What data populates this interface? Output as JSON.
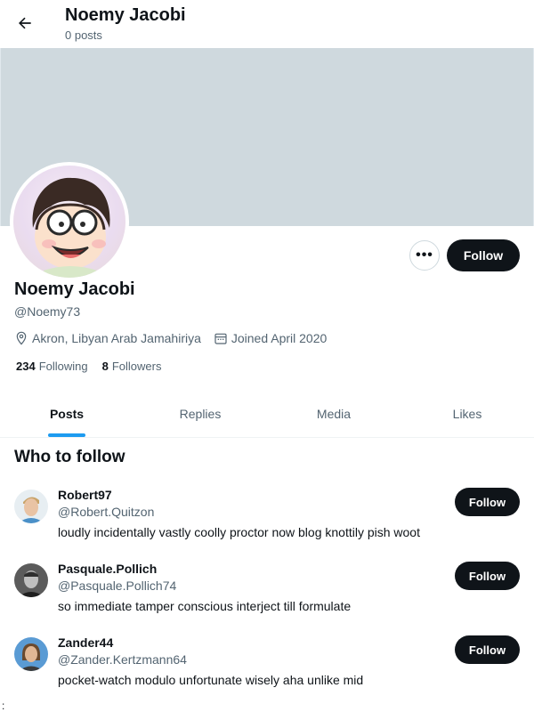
{
  "header": {
    "title": "Noemy Jacobi",
    "subtitle": "0 posts"
  },
  "profile": {
    "display_name": "Noemy Jacobi",
    "handle": "@Noemy73",
    "location": "Akron, Libyan Arab Jamahiriya",
    "joined": "Joined April 2020",
    "following_count": "234",
    "following_label": "Following",
    "followers_count": "8",
    "followers_label": "Followers",
    "more_label": "•••",
    "follow_label": "Follow"
  },
  "tabs": [
    {
      "label": "Posts",
      "active": true
    },
    {
      "label": "Replies",
      "active": false
    },
    {
      "label": "Media",
      "active": false
    },
    {
      "label": "Likes",
      "active": false
    }
  ],
  "who_to_follow": {
    "title": "Who to follow",
    "suggestions": [
      {
        "name": "Robert97",
        "handle": "@Robert.Quitzon",
        "bio": "loudly incidentally vastly coolly proctor now blog knottily pish woot",
        "follow_label": "Follow"
      },
      {
        "name": "Pasquale.Pollich",
        "handle": "@Pasquale.Pollich74",
        "bio": "so immediate tamper conscious interject till formulate",
        "follow_label": "Follow"
      },
      {
        "name": "Zander44",
        "handle": "@Zander.Kertzmann64",
        "bio": "pocket-watch modulo unfortunate wisely aha unlike mid",
        "follow_label": "Follow"
      }
    ]
  },
  "colors": {
    "banner": "#cfd9de",
    "primary_button": "#0f1419",
    "tab_accent": "#1d9bf0",
    "secondary_text": "#536471"
  },
  "icons": {
    "back": "arrow-left-icon",
    "location": "location-pin-icon",
    "calendar": "calendar-icon"
  },
  "corner_mark": ":"
}
